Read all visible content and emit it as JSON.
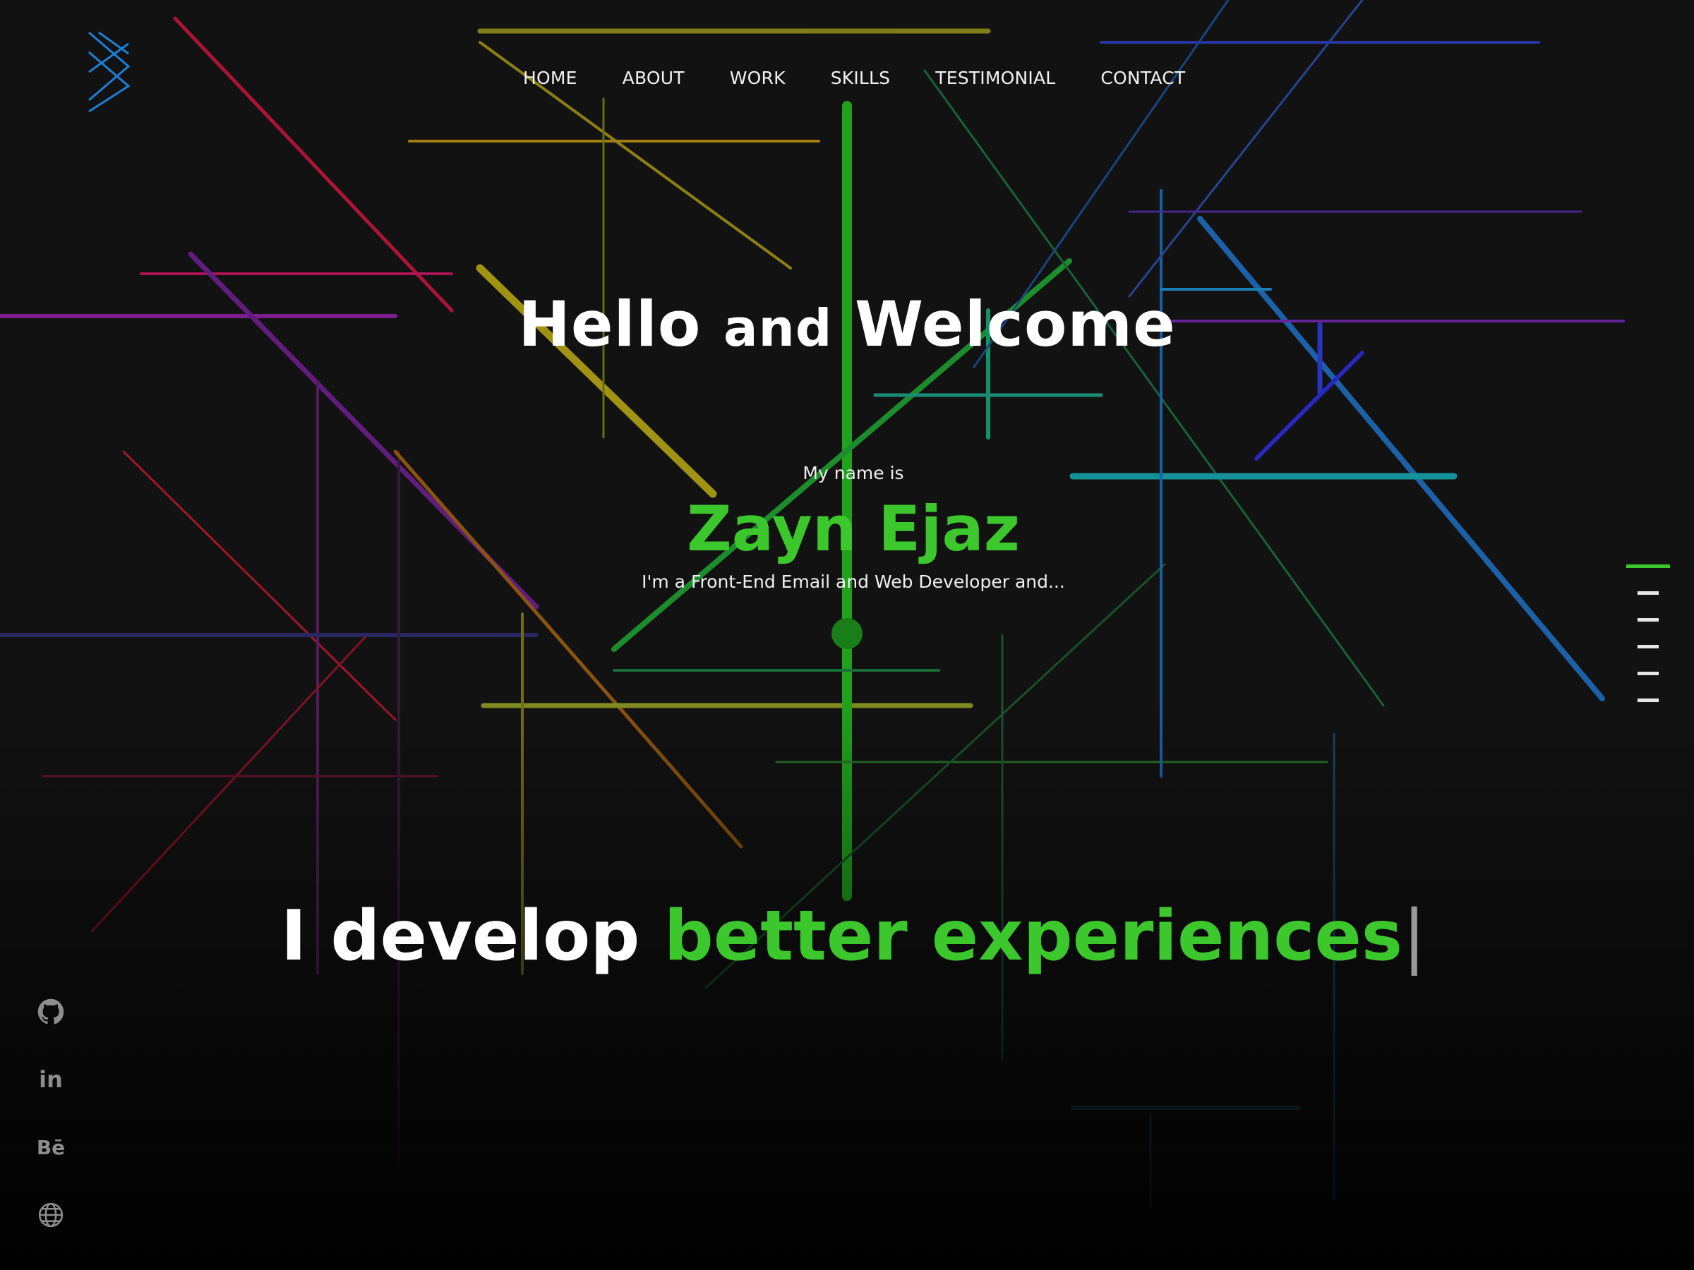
{
  "nav": {
    "items": [
      {
        "label": "HOME"
      },
      {
        "label": "ABOUT"
      },
      {
        "label": "WORK"
      },
      {
        "label": "SKILLS"
      },
      {
        "label": "TESTIMONIAL"
      },
      {
        "label": "CONTACT"
      }
    ]
  },
  "hero": {
    "title_part1": "Hello",
    "title_part2": "and",
    "title_part3": "Welcome",
    "intro": "My name is",
    "name": "Zayn Ejaz",
    "role": "I'm a Front-End Email and Web Developer and...",
    "tagline_plain": "I develop",
    "tagline_highlight": "better experiences",
    "cursor": "|"
  },
  "social": {
    "items": [
      {
        "icon": "github-icon"
      },
      {
        "icon": "linkedin-icon",
        "text": "in"
      },
      {
        "icon": "behance-icon",
        "text": "Bē"
      },
      {
        "icon": "globe-icon"
      }
    ]
  },
  "section_dots": {
    "count": 6,
    "active_index": 0
  },
  "colors": {
    "accent": "#3cc82c",
    "background": "#0e0e0e",
    "logo": "#1e7fd6"
  }
}
